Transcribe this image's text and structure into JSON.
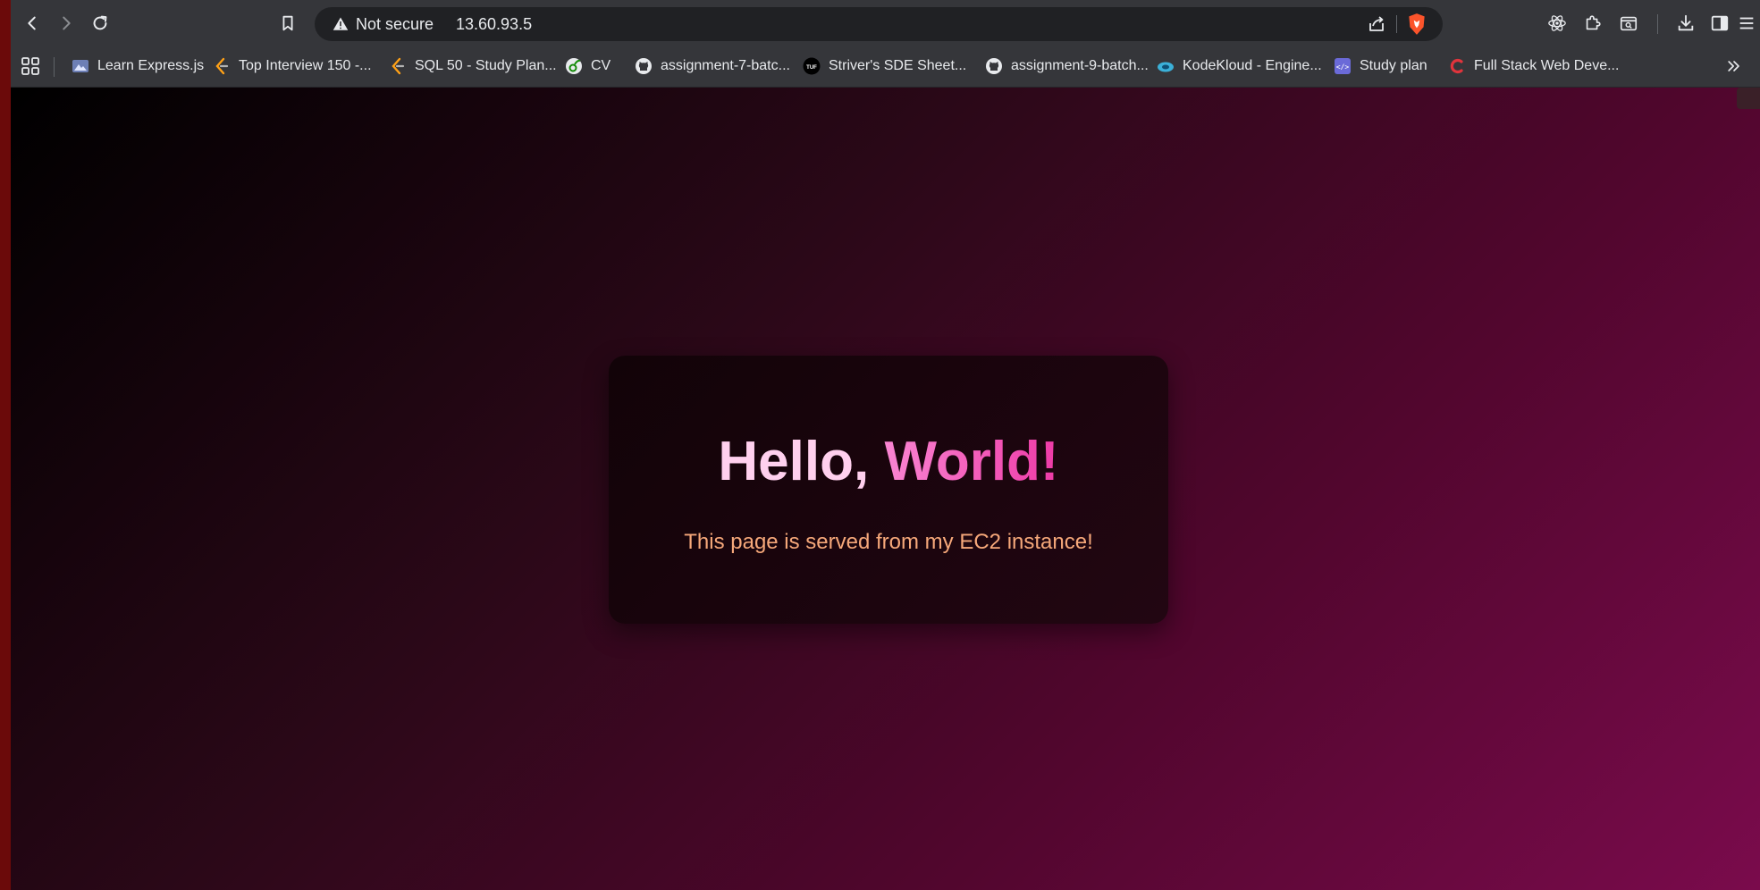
{
  "browser": {
    "security_label": "Not secure",
    "url": "13.60.93.5"
  },
  "bookmarks": [
    {
      "label": "Learn Express.js",
      "icon": "express-favicon"
    },
    {
      "label": "Top Interview 150 -...",
      "icon": "leetcode-favicon"
    },
    {
      "label": "SQL 50 - Study Plan...",
      "icon": "leetcode-favicon"
    },
    {
      "label": "CV",
      "icon": "overleaf-favicon"
    },
    {
      "label": "assignment-7-batc...",
      "icon": "github-favicon"
    },
    {
      "label": "Striver's SDE Sheet...",
      "icon": "tuf-favicon"
    },
    {
      "label": "assignment-9-batch...",
      "icon": "github-favicon"
    },
    {
      "label": "KodeKloud - Engine...",
      "icon": "kodekloud-favicon"
    },
    {
      "label": "Study plan",
      "icon": "code-favicon"
    },
    {
      "label": "Full Stack Web Deve...",
      "icon": "c-favicon"
    }
  ],
  "page": {
    "greeting_word1": "Hello,",
    "greeting_word2": "World!",
    "subtitle": "This page is served from my EC2 instance!"
  },
  "colors": {
    "toolbar_bg": "#35363a",
    "page_gradient_start": "#000000",
    "page_gradient_end": "#7a0b4c",
    "headline_light": "#ffd0ee",
    "headline_accent": "#ee3aa6",
    "subtitle": "#f6a87a"
  }
}
